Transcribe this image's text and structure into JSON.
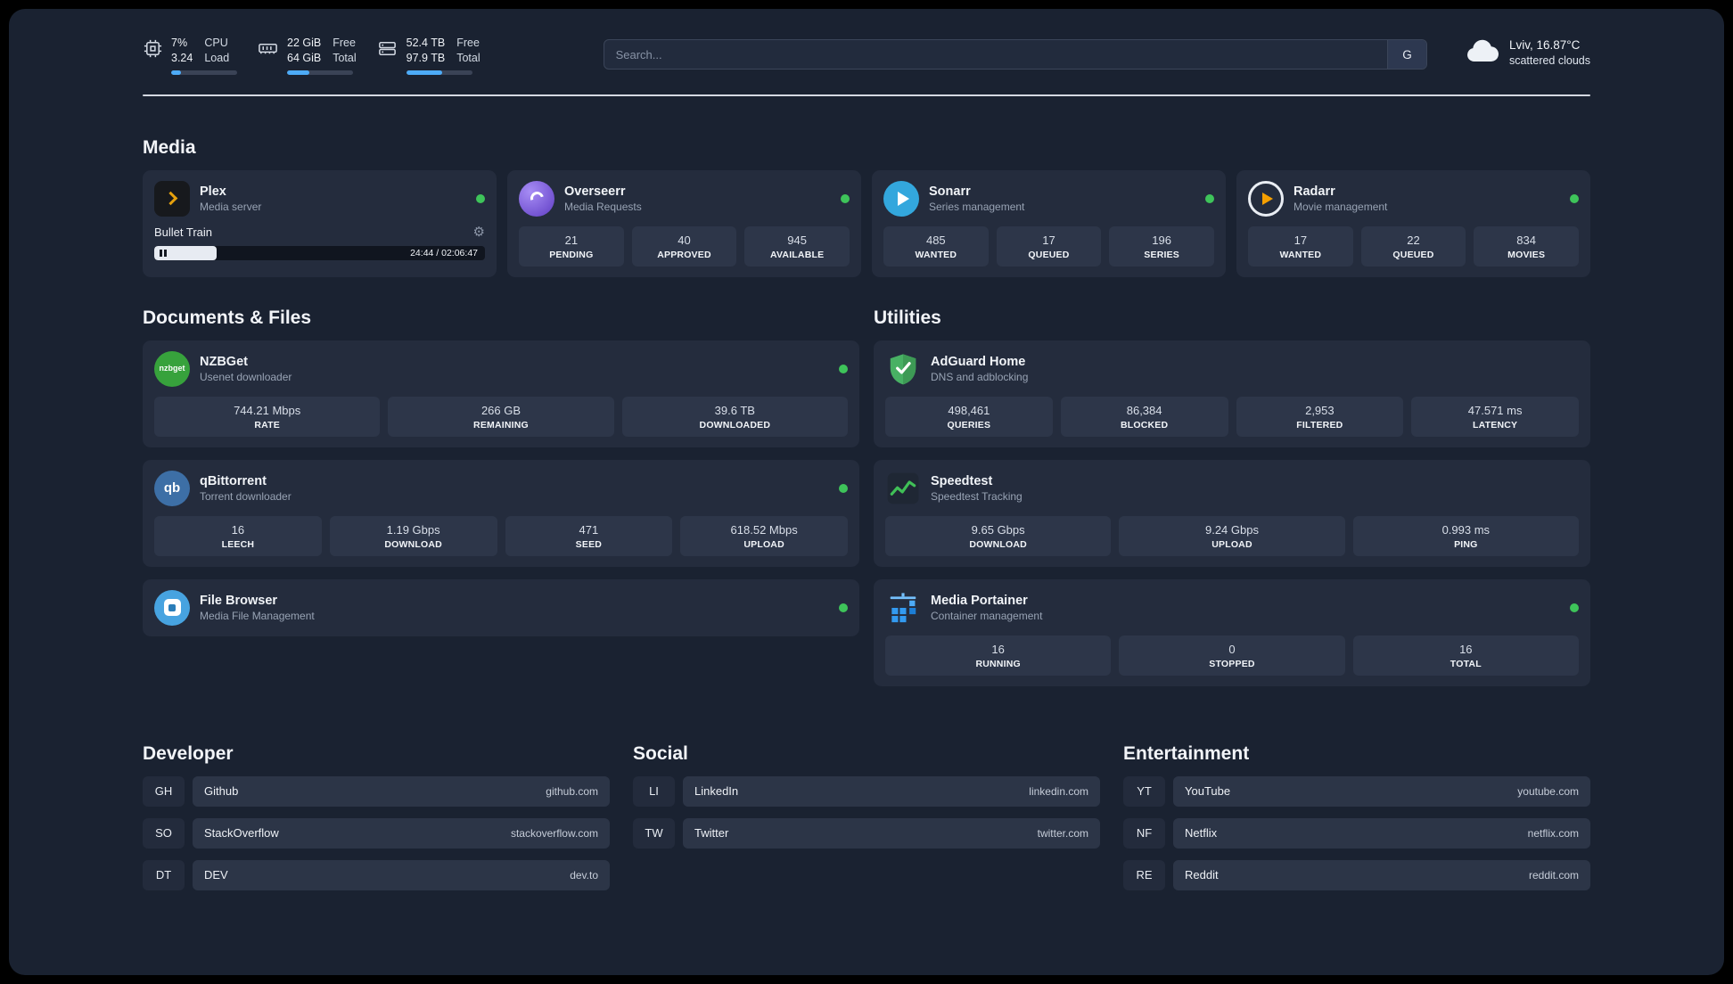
{
  "colors": {
    "background": "#1a2231",
    "card": "#242c3d",
    "tile": "#2d3649",
    "accent_blue": "#4dabf7",
    "status_online": "#3ec45a",
    "plex_gold": "#e5a00d"
  },
  "header": {
    "cpu": {
      "percent": "7%",
      "load": "3.24",
      "label_top": "CPU",
      "label_bottom": "Load",
      "bar_percent": 15
    },
    "ram": {
      "free": "22 GiB",
      "total": "64 GiB",
      "label_top": "Free",
      "label_bottom": "Total",
      "bar_percent": 34
    },
    "disk": {
      "free": "52.4 TB",
      "total": "97.9 TB",
      "label_top": "Free",
      "label_bottom": "Total",
      "bar_percent": 54
    },
    "search": {
      "placeholder": "Search...",
      "engine_button": "G"
    },
    "weather": {
      "location": "Lviv, 16.87°C",
      "condition": "scattered clouds"
    }
  },
  "sections": {
    "media": "Media",
    "documents": "Documents & Files",
    "utilities": "Utilities"
  },
  "media": {
    "plex": {
      "name": "Plex",
      "desc": "Media server",
      "now_playing": "Bullet Train",
      "time": "24:44 / 02:06:47",
      "progress_percent": 19
    },
    "overseerr": {
      "name": "Overseerr",
      "desc": "Media Requests",
      "stats": [
        {
          "value": "21",
          "label": "PENDING"
        },
        {
          "value": "40",
          "label": "APPROVED"
        },
        {
          "value": "945",
          "label": "AVAILABLE"
        }
      ]
    },
    "sonarr": {
      "name": "Sonarr",
      "desc": "Series management",
      "stats": [
        {
          "value": "485",
          "label": "WANTED"
        },
        {
          "value": "17",
          "label": "QUEUED"
        },
        {
          "value": "196",
          "label": "SERIES"
        }
      ]
    },
    "radarr": {
      "name": "Radarr",
      "desc": "Movie management",
      "stats": [
        {
          "value": "17",
          "label": "WANTED"
        },
        {
          "value": "22",
          "label": "QUEUED"
        },
        {
          "value": "834",
          "label": "MOVIES"
        }
      ]
    }
  },
  "documents": {
    "nzbget": {
      "name": "NZBGet",
      "desc": "Usenet downloader",
      "icon_text": "nzbget",
      "stats": [
        {
          "value": "744.21 Mbps",
          "label": "RATE"
        },
        {
          "value": "266 GB",
          "label": "REMAINING"
        },
        {
          "value": "39.6 TB",
          "label": "DOWNLOADED"
        }
      ]
    },
    "qbittorrent": {
      "name": "qBittorrent",
      "desc": "Torrent downloader",
      "icon_text": "qb",
      "stats": [
        {
          "value": "16",
          "label": "LEECH"
        },
        {
          "value": "1.19 Gbps",
          "label": "DOWNLOAD"
        },
        {
          "value": "471",
          "label": "SEED"
        },
        {
          "value": "618.52 Mbps",
          "label": "UPLOAD"
        }
      ]
    },
    "filebrowser": {
      "name": "File Browser",
      "desc": "Media File Management"
    }
  },
  "utilities": {
    "adguard": {
      "name": "AdGuard Home",
      "desc": "DNS and adblocking",
      "stats": [
        {
          "value": "498,461",
          "label": "QUERIES"
        },
        {
          "value": "86,384",
          "label": "BLOCKED"
        },
        {
          "value": "2,953",
          "label": "FILTERED"
        },
        {
          "value": "47.571 ms",
          "label": "LATENCY"
        }
      ]
    },
    "speedtest": {
      "name": "Speedtest",
      "desc": "Speedtest Tracking",
      "stats": [
        {
          "value": "9.65 Gbps",
          "label": "DOWNLOAD"
        },
        {
          "value": "9.24 Gbps",
          "label": "UPLOAD"
        },
        {
          "value": "0.993 ms",
          "label": "PING"
        }
      ]
    },
    "portainer": {
      "name": "Media Portainer",
      "desc": "Container management",
      "stats": [
        {
          "value": "16",
          "label": "RUNNING"
        },
        {
          "value": "0",
          "label": "STOPPED"
        },
        {
          "value": "16",
          "label": "TOTAL"
        }
      ]
    }
  },
  "bookmarks": {
    "developer": {
      "title": "Developer",
      "items": [
        {
          "abbr": "GH",
          "name": "Github",
          "url": "github.com"
        },
        {
          "abbr": "SO",
          "name": "StackOverflow",
          "url": "stackoverflow.com"
        },
        {
          "abbr": "DT",
          "name": "DEV",
          "url": "dev.to"
        }
      ]
    },
    "social": {
      "title": "Social",
      "items": [
        {
          "abbr": "LI",
          "name": "LinkedIn",
          "url": "linkedin.com"
        },
        {
          "abbr": "TW",
          "name": "Twitter",
          "url": "twitter.com"
        }
      ]
    },
    "entertainment": {
      "title": "Entertainment",
      "items": [
        {
          "abbr": "YT",
          "name": "YouTube",
          "url": "youtube.com"
        },
        {
          "abbr": "NF",
          "name": "Netflix",
          "url": "netflix.com"
        },
        {
          "abbr": "RE",
          "name": "Reddit",
          "url": "reddit.com"
        }
      ]
    }
  }
}
